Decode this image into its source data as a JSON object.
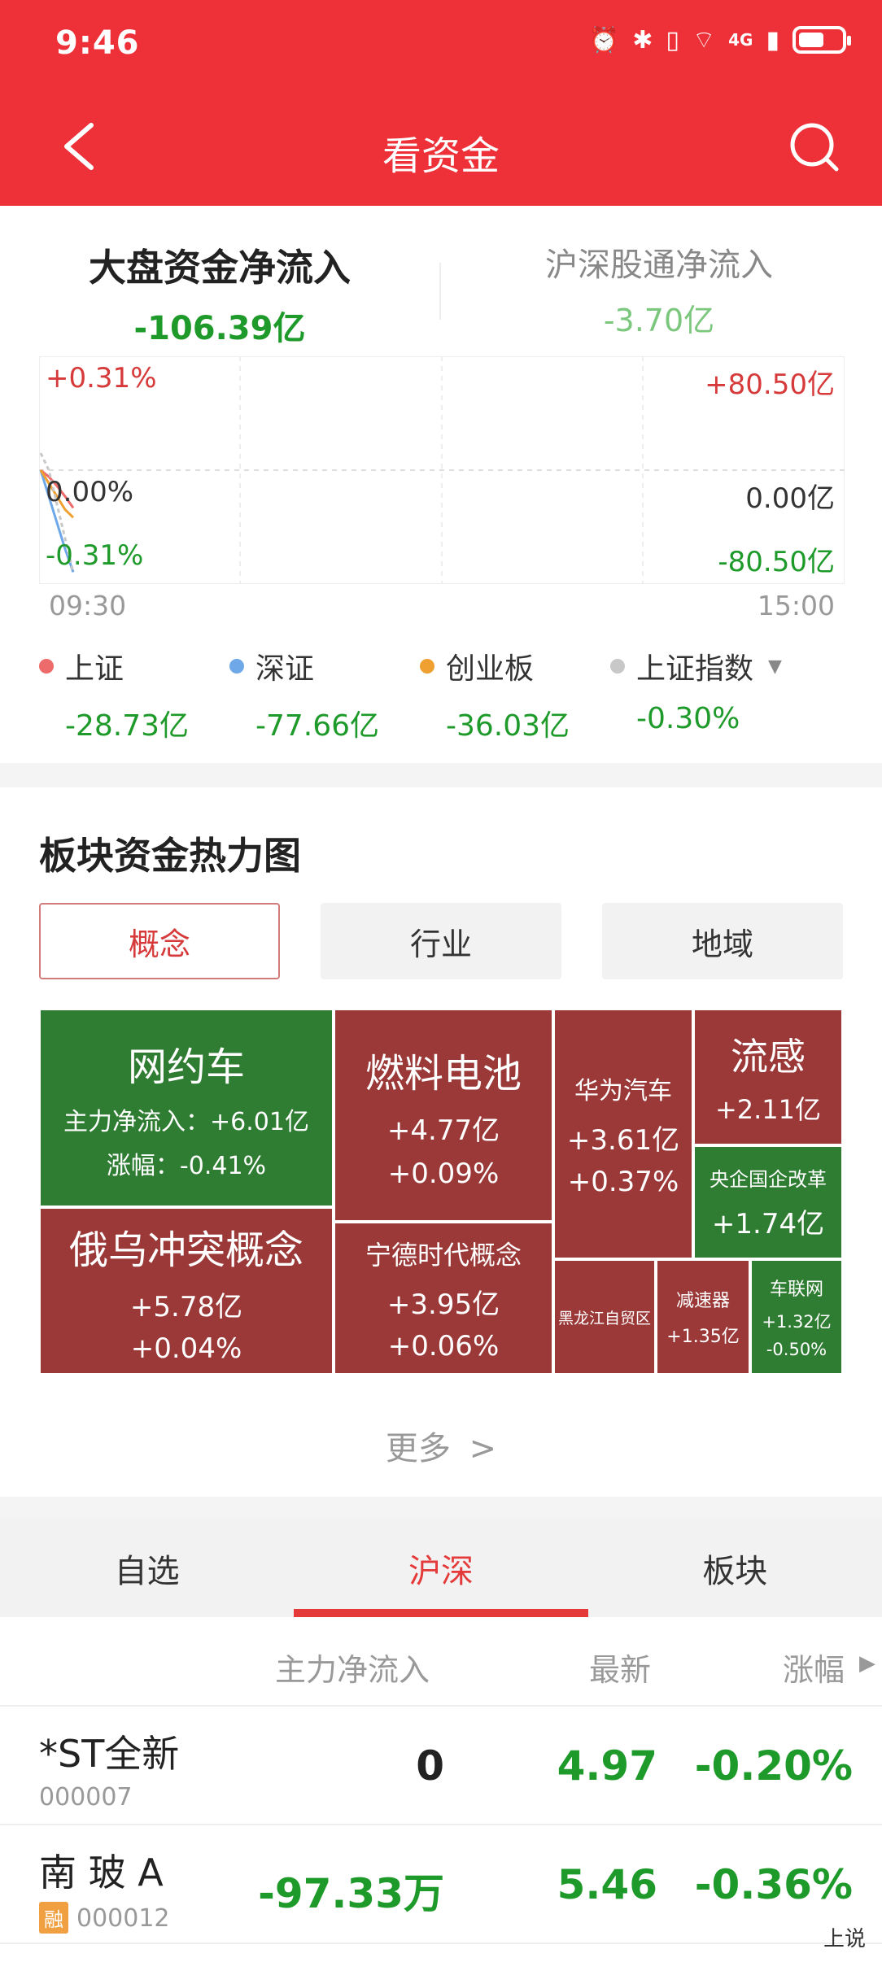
{
  "status": {
    "time": "9:46",
    "network": "4G"
  },
  "nav": {
    "title": "看资金"
  },
  "flow_tabs": {
    "main": {
      "label": "大盘资金净流入",
      "value": "-106.39亿"
    },
    "sub": {
      "label": "沪深股通净流入",
      "value": "-3.70亿"
    }
  },
  "chart_data": {
    "type": "line",
    "left_axis": {
      "top": "+0.31%",
      "mid": "0.00%",
      "bottom": "-0.31%"
    },
    "right_axis": {
      "top": "+80.50亿",
      "mid": "0.00亿",
      "bottom": "-80.50亿"
    },
    "time_start": "09:30",
    "time_end": "15:00",
    "series": [
      {
        "name": "上证",
        "color": "#ee6b6b",
        "values": [
          0,
          -5,
          -12,
          -20,
          -28.73
        ]
      },
      {
        "name": "深证",
        "color": "#6ea8e8",
        "values": [
          0,
          -20,
          -40,
          -60,
          -77.66
        ]
      },
      {
        "name": "创业板",
        "color": "#f0a030",
        "values": [
          0,
          -10,
          -20,
          -30,
          -36.03
        ]
      },
      {
        "name": "上证指数",
        "color": "#c8c8c8",
        "values": [
          0.05,
          0.0,
          -0.1,
          -0.2,
          -0.3
        ]
      }
    ]
  },
  "legend": [
    {
      "name": "上证",
      "value": "-28.73亿",
      "color": "#ee6b6b"
    },
    {
      "name": "深证",
      "value": "-77.66亿",
      "color": "#6ea8e8"
    },
    {
      "name": "创业板",
      "value": "-36.03亿",
      "color": "#f0a030"
    },
    {
      "name": "上证指数",
      "value": "-0.30%",
      "color": "#c8c8c8"
    }
  ],
  "heatmap": {
    "title": "板块资金热力图",
    "segments": [
      "概念",
      "行业",
      "地域"
    ],
    "more": "更多",
    "tiles": {
      "t1": {
        "name": "网约车",
        "l1": "主力净流入：+6.01亿",
        "l2": "涨幅：-0.41%"
      },
      "t2": {
        "name": "燃料电池",
        "l1": "+4.77亿",
        "l2": "+0.09%"
      },
      "t3": {
        "name": "华为汽车",
        "l1": "+3.61亿",
        "l2": "+0.37%"
      },
      "t4": {
        "name": "流感",
        "l1": "+2.11亿"
      },
      "t5": {
        "name": "央企国企改革",
        "l1": "+1.74亿"
      },
      "t6": {
        "name": "俄乌冲突概念",
        "l1": "+5.78亿",
        "l2": "+0.04%"
      },
      "t7": {
        "name": "宁德时代概念",
        "l1": "+3.95亿",
        "l2": "+0.06%"
      },
      "t8": {
        "name": "黑龙江自贸区"
      },
      "t9": {
        "name": "减速器",
        "l1": "+1.35亿"
      },
      "t10": {
        "name": "车联网",
        "l1": "+1.32亿",
        "l2": "-0.50%"
      }
    }
  },
  "bottom_tabs": [
    "自选",
    "沪深",
    "板块"
  ],
  "table": {
    "headers": {
      "flow": "主力净流入",
      "latest": "最新",
      "change": "涨幅"
    },
    "rows": [
      {
        "name": "*ST全新",
        "code": "000007",
        "badge": "",
        "flow": "0",
        "latest": "4.97",
        "change": "-0.20%"
      },
      {
        "name": "南 玻 A",
        "code": "000012",
        "badge": "融",
        "flow": "-97.33万",
        "latest": "5.46",
        "change": "-0.36%"
      }
    ]
  },
  "watermark": "上说"
}
